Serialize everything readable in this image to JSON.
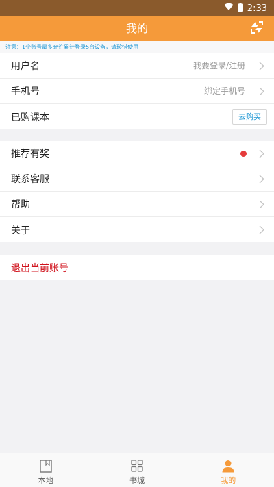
{
  "status_bar": {
    "time": "2:33",
    "wifi_icon": "wifi-icon",
    "battery_icon": "battery-icon"
  },
  "header": {
    "title": "我的",
    "sync_icon": "sync-icon"
  },
  "notice": "注意：1个账号最多允许累计登录5台设备，请珍惜使用",
  "account_section": {
    "username_label": "用户名",
    "username_hint": "我要登录/注册",
    "phone_label": "手机号",
    "phone_hint": "绑定手机号",
    "purchased_label": "已购课本",
    "buy_button": "去购买"
  },
  "misc_section": {
    "referral_label": "推荐有奖",
    "service_label": "联系客服",
    "help_label": "帮助",
    "about_label": "关于"
  },
  "logout_label": "退出当前账号",
  "bottom_nav": {
    "local": "本地",
    "store": "书城",
    "mine": "我的",
    "active": "mine"
  },
  "colors": {
    "accent": "#f59a3a",
    "status_bar": "#8a5a2c",
    "link": "#1f97d4",
    "danger": "#d0111b",
    "dot": "#e53b3b"
  }
}
